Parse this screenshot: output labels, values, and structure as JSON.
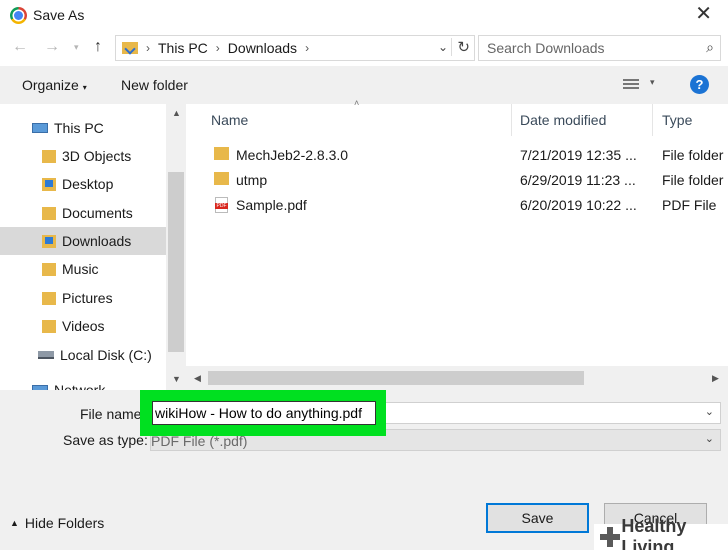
{
  "window": {
    "title": "Save As",
    "close_icon": "close-icon"
  },
  "nav": {
    "address": {
      "segments": [
        "This PC",
        "Downloads"
      ]
    },
    "search": {
      "placeholder": "Search Downloads"
    }
  },
  "toolbar": {
    "organize_label": "Organize",
    "new_folder_label": "New folder",
    "help_label": "?"
  },
  "sidebar": {
    "items": [
      {
        "label": "This PC",
        "icon": "pc-icon"
      },
      {
        "label": "3D Objects",
        "icon": "folder-icon"
      },
      {
        "label": "Desktop",
        "icon": "desktop-icon"
      },
      {
        "label": "Documents",
        "icon": "documents-icon"
      },
      {
        "label": "Downloads",
        "icon": "downloads-icon",
        "selected": true
      },
      {
        "label": "Music",
        "icon": "music-icon"
      },
      {
        "label": "Pictures",
        "icon": "pictures-icon"
      },
      {
        "label": "Videos",
        "icon": "videos-icon"
      },
      {
        "label": "Local Disk (C:)",
        "icon": "disk-icon"
      },
      {
        "label": "Network",
        "icon": "network-icon"
      }
    ]
  },
  "files": {
    "columns": {
      "name": "Name",
      "date": "Date modified",
      "type": "Type"
    },
    "rows": [
      {
        "name": "MechJeb2-2.8.3.0",
        "date": "7/21/2019 12:35 ...",
        "type": "File folder",
        "icon": "folder-icon"
      },
      {
        "name": "utmp",
        "date": "6/29/2019 11:23 ...",
        "type": "File folder",
        "icon": "folder-icon"
      },
      {
        "name": "Sample.pdf",
        "date": "6/20/2019 10:22 ...",
        "type": "PDF File",
        "icon": "pdf-icon"
      }
    ]
  },
  "form": {
    "file_name_label": "File name:",
    "file_name_value": "wikiHow - How to do anything.pdf",
    "save_as_type_label": "Save as type:",
    "save_as_type_value": "PDF File (*.pdf)"
  },
  "footer": {
    "hide_folders_label": "Hide Folders",
    "save_label": "Save",
    "cancel_label": "Cancel"
  },
  "watermark": {
    "text": "Healthy Living"
  },
  "colors": {
    "highlight": "#00e020",
    "accent": "#0078d7",
    "selected_row": "#d9d9d9"
  }
}
